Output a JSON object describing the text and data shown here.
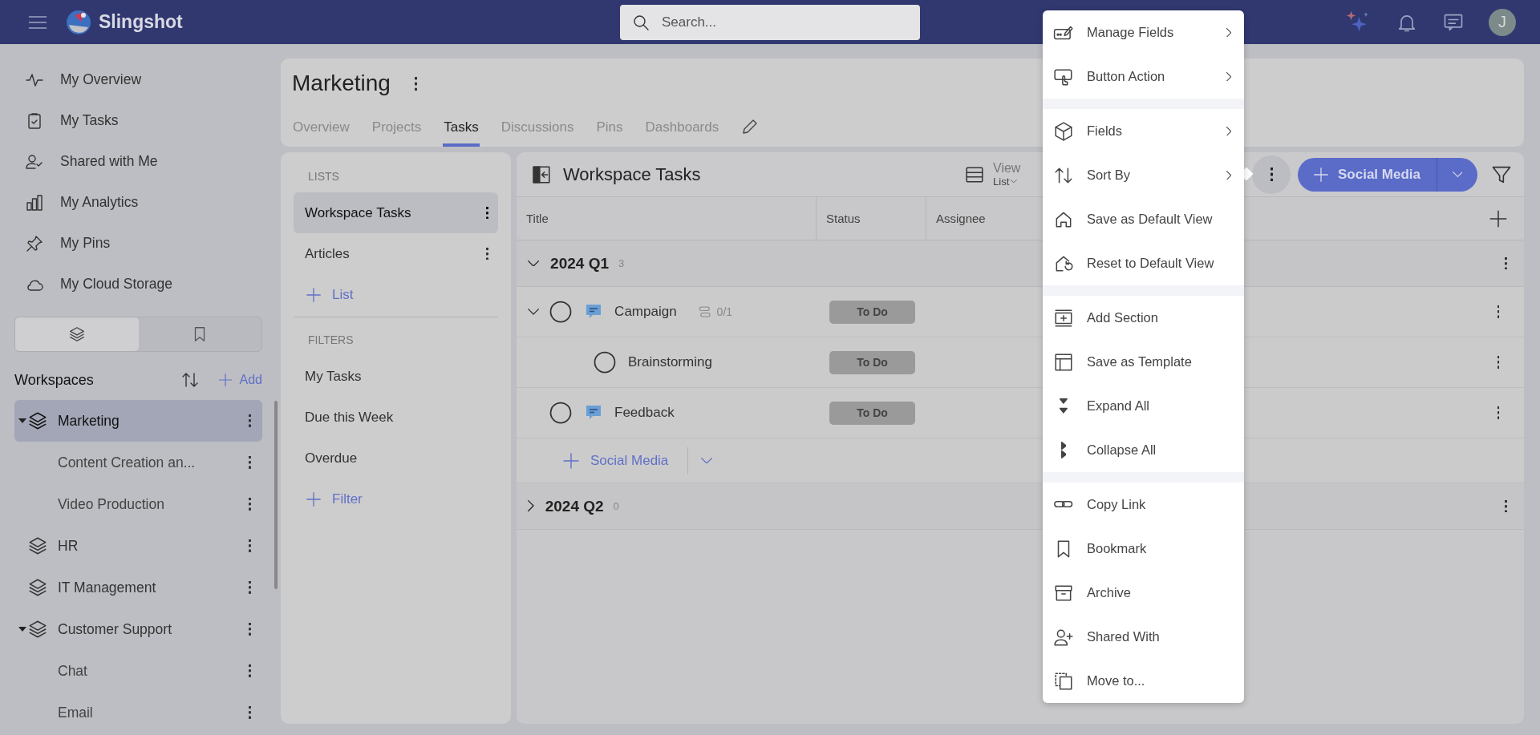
{
  "topbar": {
    "app_name": "Slingshot",
    "search_placeholder": "Search...",
    "avatar_initial": "J"
  },
  "sidebar": {
    "nav": [
      {
        "label": "My Overview"
      },
      {
        "label": "My Tasks"
      },
      {
        "label": "Shared with Me"
      },
      {
        "label": "My Analytics"
      },
      {
        "label": "My Pins"
      },
      {
        "label": "My Cloud Storage"
      }
    ],
    "view_tabs": [
      {
        "selected": true
      },
      {
        "selected": false
      }
    ],
    "workspaces_title": "Workspaces",
    "add_label": "Add",
    "workspaces": [
      {
        "name": "Marketing",
        "selected": true,
        "expanded": true,
        "children": [
          {
            "name": "Content Creation an..."
          },
          {
            "name": "Video Production"
          }
        ]
      },
      {
        "name": "HR",
        "selected": false,
        "expanded": false
      },
      {
        "name": "IT Management",
        "selected": false,
        "expanded": false
      },
      {
        "name": "Customer Support",
        "selected": false,
        "expanded": true,
        "children": [
          {
            "name": "Chat"
          },
          {
            "name": "Email"
          }
        ]
      }
    ]
  },
  "header": {
    "title": "Marketing",
    "tabs": [
      {
        "label": "Overview",
        "selected": false
      },
      {
        "label": "Projects",
        "selected": false
      },
      {
        "label": "Tasks",
        "selected": true
      },
      {
        "label": "Discussions",
        "selected": false
      },
      {
        "label": "Pins",
        "selected": false
      },
      {
        "label": "Dashboards",
        "selected": false
      }
    ]
  },
  "lists_panel": {
    "lists_heading": "LISTS",
    "lists": [
      {
        "label": "Workspace Tasks",
        "selected": true
      },
      {
        "label": "Articles",
        "selected": false
      }
    ],
    "add_list": "List",
    "filters_heading": "FILTERS",
    "filters": [
      {
        "label": "My Tasks",
        "selected": false
      },
      {
        "label": "Due this Week",
        "selected": false
      },
      {
        "label": "Overdue",
        "selected": false
      }
    ],
    "add_filter": "Filter"
  },
  "main": {
    "title": "Workspace Tasks",
    "view_label": "View",
    "view_mode": "List",
    "new_button": "Social Media",
    "columns": [
      "Title",
      "Status",
      "Assignee"
    ],
    "groups": [
      {
        "name": "2024 Q1",
        "count": "3",
        "expanded": true,
        "add_label": "Social Media",
        "tasks": [
          {
            "title": "Campaign",
            "comment": true,
            "subtasks": "0/1",
            "status": "To Do",
            "expanded": true,
            "children": [
              {
                "title": "Brainstorming",
                "comment": false,
                "status": "To Do"
              }
            ]
          },
          {
            "title": "Feedback",
            "comment": true,
            "status": "To Do"
          }
        ]
      },
      {
        "name": "2024 Q2",
        "count": "0",
        "expanded": false
      }
    ]
  },
  "menu": {
    "sections": [
      {
        "items": [
          {
            "label": "Manage Fields",
            "submenu": true
          },
          {
            "label": "Button Action",
            "submenu": true
          }
        ]
      },
      {
        "items": [
          {
            "label": "Fields",
            "submenu": true
          },
          {
            "label": "Sort By",
            "submenu": true
          },
          {
            "label": "Save as Default View",
            "submenu": false
          },
          {
            "label": "Reset to Default View",
            "submenu": false
          }
        ]
      },
      {
        "items": [
          {
            "label": "Add Section",
            "submenu": false
          },
          {
            "label": "Save as Template",
            "submenu": false
          },
          {
            "label": "Expand All",
            "submenu": false
          },
          {
            "label": "Collapse All",
            "submenu": false
          }
        ]
      },
      {
        "items": [
          {
            "label": "Copy Link",
            "submenu": false
          },
          {
            "label": "Bookmark",
            "submenu": false
          },
          {
            "label": "Archive",
            "submenu": false
          },
          {
            "label": "Shared With",
            "submenu": false
          },
          {
            "label": "Move to...",
            "submenu": false
          }
        ]
      }
    ]
  }
}
